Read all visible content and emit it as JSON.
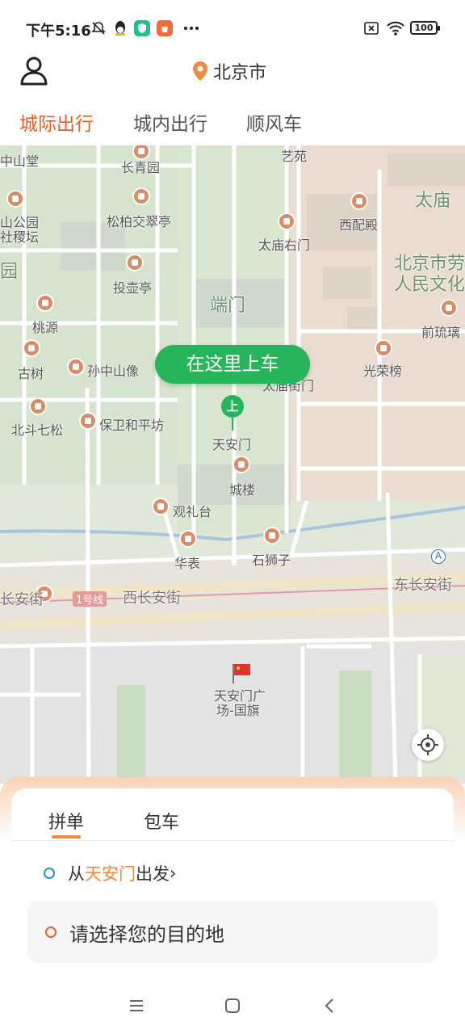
{
  "status_bar": {
    "time": "下午5:16",
    "battery": "100"
  },
  "header": {
    "city": "北京市"
  },
  "tabs": [
    {
      "label": "城际出行",
      "active": true
    },
    {
      "label": "城内出行",
      "active": false
    },
    {
      "label": "顺风车",
      "active": false
    }
  ],
  "map": {
    "pickup_bubble": "在这里上车",
    "pickup_pin": "上",
    "labels": {
      "zhongshantang": "中山堂",
      "changqingyuan": "长青园",
      "yiyuan": "艺苑",
      "taimiao": "太庙",
      "shanpark": "山公园",
      "shejitan": "社稷坛",
      "songbai": "松柏交翠亭",
      "xipeidian": "西配殿",
      "taimiaoyoumen": "太庙右门",
      "yuan": "园",
      "beijingshi": "北京市劳",
      "renminwenhua": "人民文化",
      "touhuting": "投壶亭",
      "duanmen": "端门",
      "taoyuan": "桃源",
      "qianliuli": "前琉璃",
      "gushu": "古树",
      "sunzhongshan": "孙中山像",
      "taimiaojiemen": "太庙街门",
      "guangrongbang": "光荣榜",
      "beidouqisong": "北斗七松",
      "baowei": "保卫和平坊",
      "tiananmen": "天安门",
      "chenglou": "城楼",
      "guanlitai": "观礼台",
      "huabiao": "华表",
      "shishizi": "石狮子",
      "xichanganjie_left": "长安街",
      "line1": "1号线",
      "xichanganjie": "西长安街",
      "dongchanganjie": "东长安街",
      "subway_a": "A",
      "flag_1": "天安门广",
      "flag_2": "场-国旗"
    }
  },
  "sheet": {
    "tab_pinche": "拼单",
    "tab_baoche": "包车",
    "from_prefix": "从",
    "from_place": "天安门",
    "from_suffix": "出发",
    "from_chevron": "›",
    "destination_placeholder": "请选择您的目的地"
  }
}
